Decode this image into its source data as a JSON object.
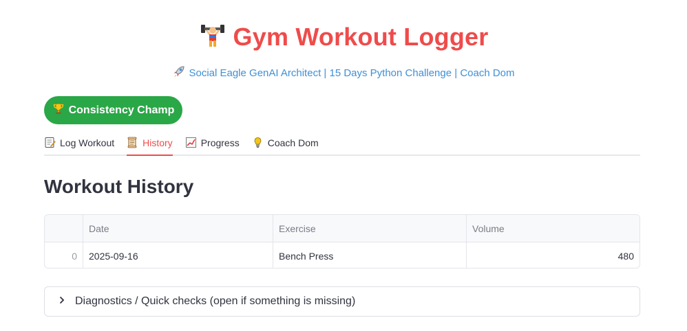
{
  "header": {
    "title": "Gym Workout Logger",
    "title_icon": "weightlifter-icon",
    "subtitle": "Social Eagle GenAI Architect | 15 Days Python Challenge | Coach Dom",
    "subtitle_icon": "rocket-icon"
  },
  "badge": {
    "label": "Consistency Champ",
    "icon": "trophy-icon",
    "color": "#2aa746"
  },
  "tabs": [
    {
      "label": "Log Workout",
      "icon": "memo-icon",
      "active": false
    },
    {
      "label": "History",
      "icon": "scroll-icon",
      "active": true
    },
    {
      "label": "Progress",
      "icon": "chart-increasing-icon",
      "active": false
    },
    {
      "label": "Coach Dom",
      "icon": "lightbulb-icon",
      "active": false
    }
  ],
  "history": {
    "title": "Workout History",
    "columns": [
      "",
      "Date",
      "Exercise",
      "Volume"
    ],
    "rows": [
      {
        "index": "0",
        "date": "2025-09-16",
        "exercise": "Bench Press",
        "volume": "480"
      }
    ]
  },
  "diagnostics": {
    "label": "Diagnostics / Quick checks (open if something is missing)"
  },
  "colors": {
    "accent": "#ef4b4b",
    "link": "#3f8fd6"
  }
}
